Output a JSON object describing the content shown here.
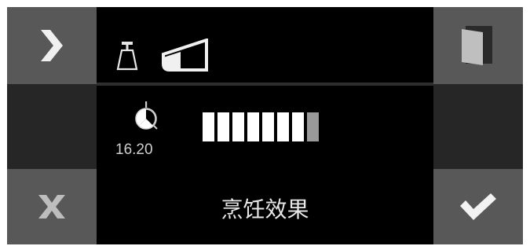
{
  "time_display": "16.20",
  "cooking_effect_label": "烹饪效果",
  "level": {
    "filled": 7,
    "partial": 1,
    "total": 8
  },
  "buttons": {
    "forward": "chevron-right-icon",
    "door": "door-icon",
    "cancel": "close-icon",
    "confirm": "checkmark-icon"
  },
  "colors": {
    "button_bg": "#585858",
    "filler_bg": "#262626",
    "screen_bg": "#000000",
    "icon_light": "#eeeeee",
    "bar_full": "#ffffff",
    "bar_partial": "#9a9a9a"
  }
}
